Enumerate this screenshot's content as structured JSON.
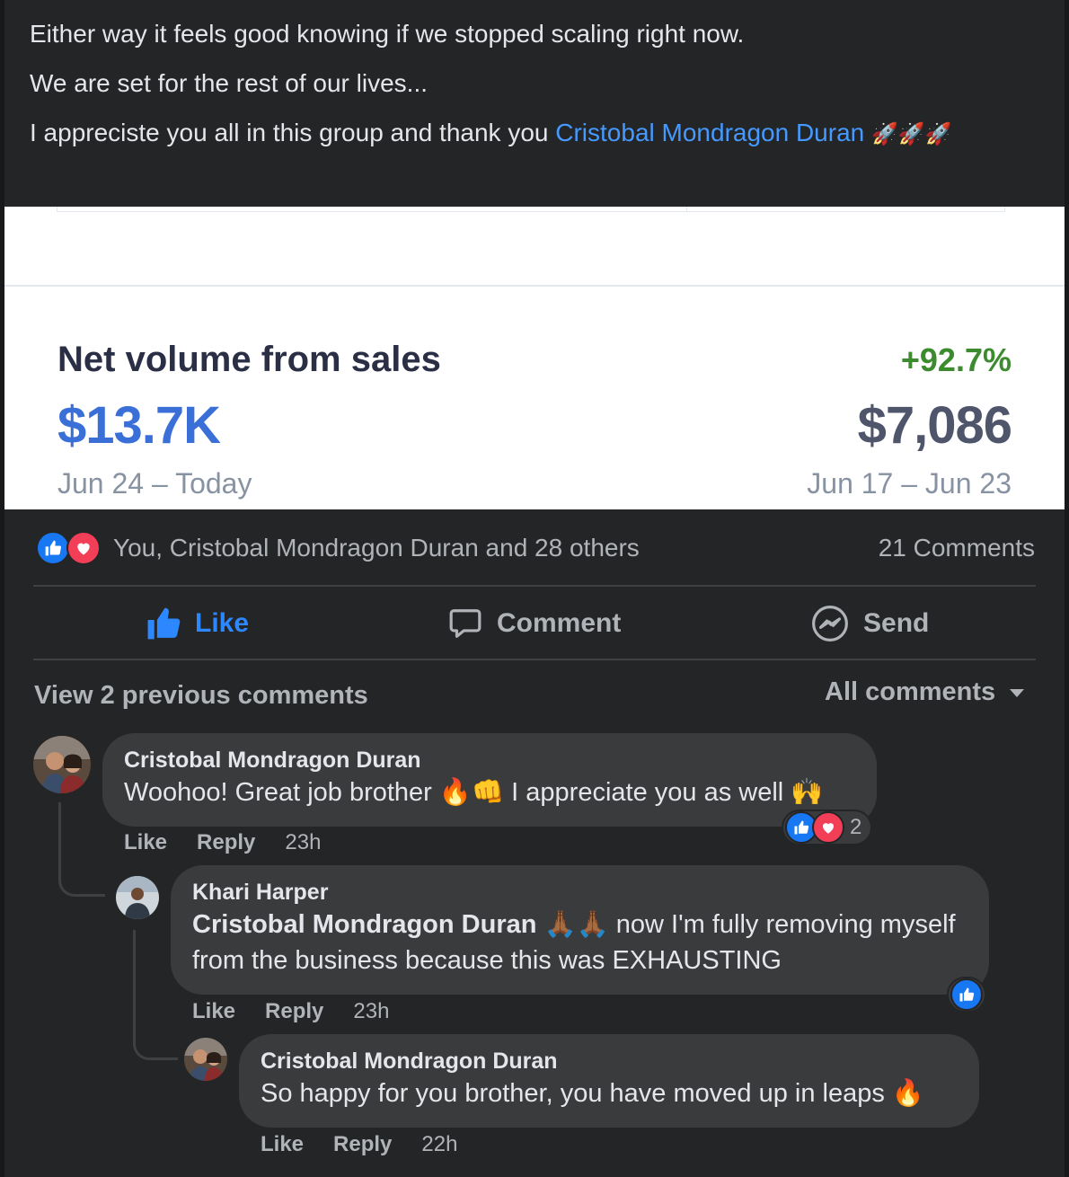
{
  "post": {
    "lines": [
      "Either way it feels good knowing if we stopped scaling right now.",
      "We are set for the rest of our lives..."
    ],
    "thanks_prefix": "I appreciste you all in this group and thank you ",
    "mention": "Cristobal Mondragon Duran",
    "thanks_emoji": "🚀🚀🚀"
  },
  "screenshot": {
    "metric_title": "Net volume from sales",
    "growth": "+92.7%",
    "current_value": "$13.7K",
    "previous_value": "$7,086",
    "current_range": "Jun 24 – Today",
    "previous_range": "Jun 17 – Jun 23"
  },
  "reactions": {
    "names": "You, Cristobal Mondragon Duran and 28 others",
    "comments_count": "21 Comments"
  },
  "actions": {
    "like": "Like",
    "comment": "Comment",
    "send": "Send"
  },
  "comments_header": {
    "view_previous": "View 2 previous comments",
    "sort": "All comments"
  },
  "comments": [
    {
      "author": "Cristobal Mondragon Duran",
      "text": "Woohoo! Great job brother 🔥👊 I appreciate you as well 🙌",
      "like": "Like",
      "reply": "Reply",
      "time": "23h",
      "reaction_count": "2"
    },
    {
      "author": "Khari Harper",
      "mention": "Cristobal Mondragon Duran",
      "text": " 🙏🏾🙏🏾 now I'm fully removing myself from the business because this was EXHAUSTING",
      "like": "Like",
      "reply": "Reply",
      "time": "23h"
    },
    {
      "author": "Cristobal Mondragon Duran",
      "text": "So happy for you brother, you have moved up in leaps 🔥",
      "like": "Like",
      "reply": "Reply",
      "time": "22h"
    }
  ],
  "colors": {
    "accent": "#2d88ff",
    "mention": "#4599ff",
    "like_blue": "#1877f2",
    "love_red": "#f33e58",
    "growth_green": "#3d8b2f"
  }
}
